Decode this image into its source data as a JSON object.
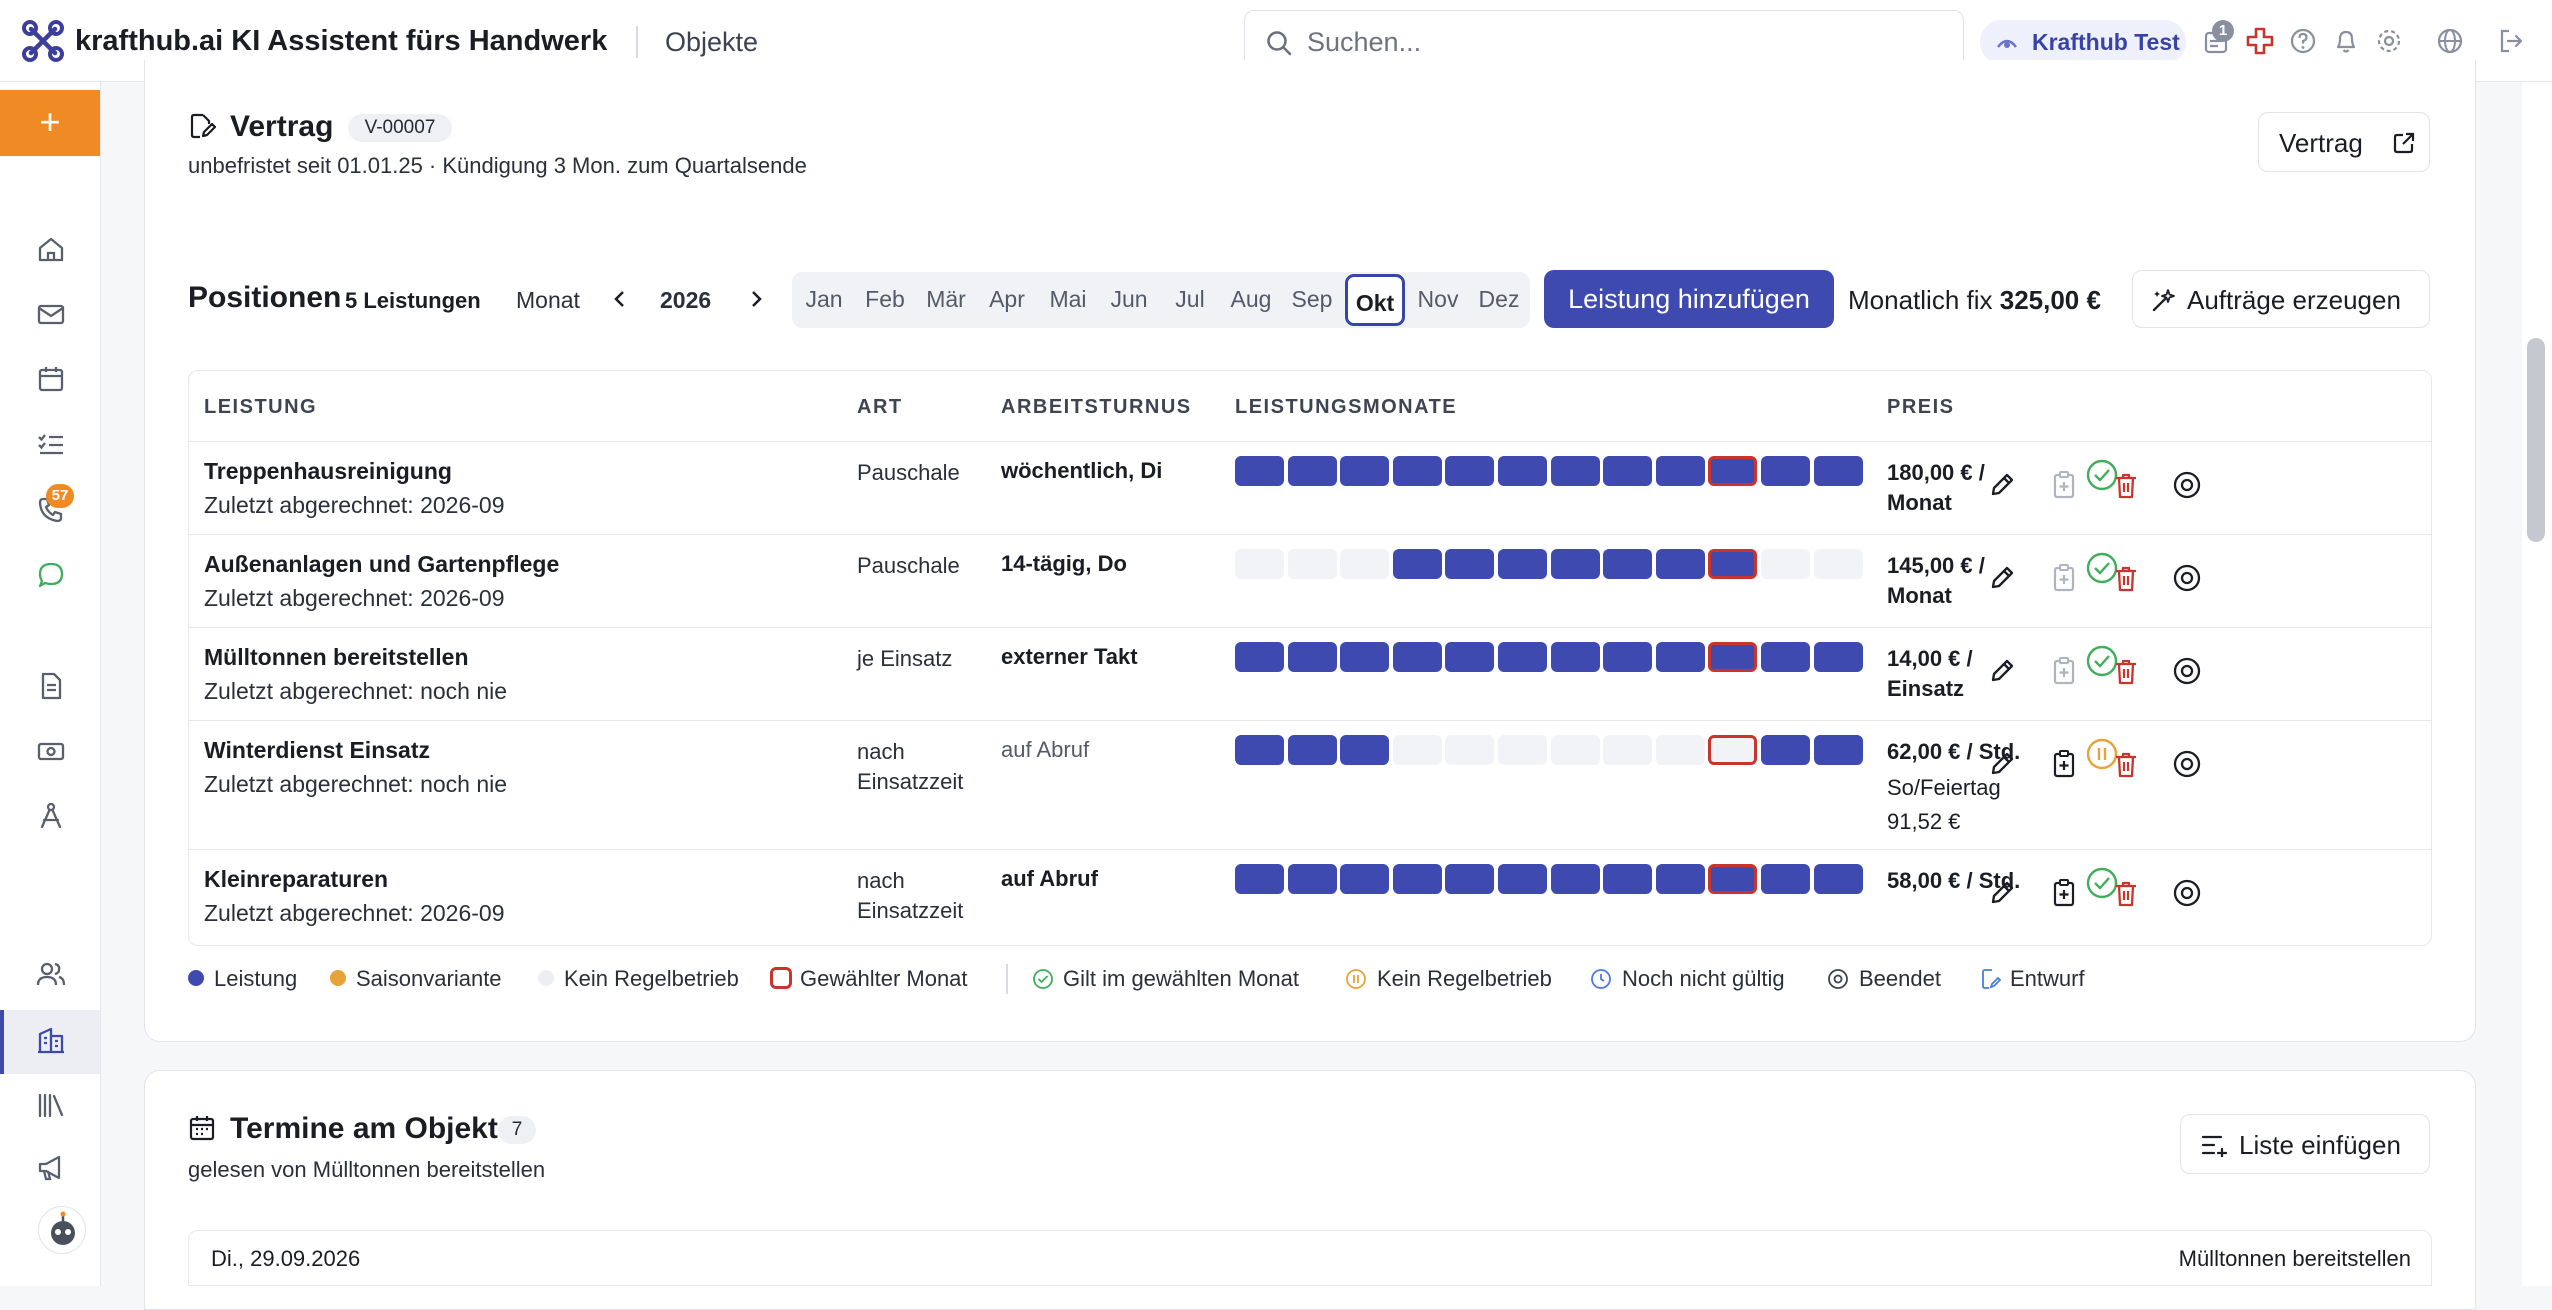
{
  "header": {
    "brand": "krafthub.ai KI Assistent fürs Handwerk",
    "breadcrumb": "Objekte",
    "search_placeholder": "Suchen...",
    "tenant": "Krafthub Test",
    "inbox_count": "1"
  },
  "sidebar": {
    "add_label": "+",
    "calls_badge": "57",
    "items": [
      "home-icon",
      "mail-icon",
      "calendar-icon",
      "tasks-icon",
      "phone-icon",
      "chat-icon",
      "document-icon",
      "money-icon",
      "compass-icon",
      "users-icon",
      "building-icon",
      "library-icon",
      "megaphone-icon"
    ],
    "active": "building-icon"
  },
  "contract": {
    "title": "Vertrag",
    "id": "V-00007",
    "subtitle": "unbefristet seit 01.01.25 · Kündigung 3 Mon. zum Quartalsende",
    "button": "Vertrag"
  },
  "positions": {
    "title": "Positionen",
    "count": "5 Leistungen",
    "period_label": "Monat",
    "year": "2026",
    "months": [
      "Jan",
      "Feb",
      "Mär",
      "Apr",
      "Mai",
      "Jun",
      "Jul",
      "Aug",
      "Sep",
      "Okt",
      "Nov",
      "Dez"
    ],
    "selected_month": "Okt",
    "add_button": "Leistung hinzufügen",
    "monthly_fixed_label": "Monatlich fix",
    "monthly_fixed_value": "325,00 €",
    "generate_button": "Aufträge erzeugen",
    "columns": [
      "LEISTUNG",
      "ART",
      "ARBEITSTURNUS",
      "LEISTUNGSMONATE",
      "PREIS"
    ],
    "rows": [
      {
        "name": "Treppenhausreinigung",
        "last": "Zuletzt abgerechnet: 2026-09",
        "art": "Pauschale",
        "turnus": "wöchentlich, Di",
        "price": "180,00 € / Monat",
        "extra": "",
        "status": "check",
        "active": [
          1,
          1,
          1,
          1,
          1,
          1,
          1,
          1,
          1,
          1,
          1,
          1
        ]
      },
      {
        "name": "Außenanlagen und Gartenpflege",
        "last": "Zuletzt abgerechnet: 2026-09",
        "art": "Pauschale",
        "turnus": "14-tägig, Do",
        "price": "145,00 € / Monat",
        "extra": "",
        "status": "check",
        "active": [
          0,
          0,
          0,
          1,
          1,
          1,
          1,
          1,
          1,
          1,
          0,
          0
        ]
      },
      {
        "name": "Mülltonnen bereitstellen",
        "last": "Zuletzt abgerechnet: noch nie",
        "art": "je Einsatz",
        "turnus": "externer Takt",
        "price": "14,00 € / Einsatz",
        "extra": "",
        "status": "check",
        "active": [
          1,
          1,
          1,
          1,
          1,
          1,
          1,
          1,
          1,
          1,
          1,
          1
        ]
      },
      {
        "name": "Winterdienst Einsatz",
        "last": "Zuletzt abgerechnet: noch nie",
        "art": "nach Einsatzzeit",
        "turnus": "auf Abruf",
        "price": "62,00 € / Std.",
        "extra": "So/Feiertag 91,52 €",
        "status": "pause",
        "active": [
          1,
          1,
          1,
          0,
          0,
          0,
          0,
          0,
          0,
          0,
          1,
          1
        ]
      },
      {
        "name": "Kleinreparaturen",
        "last": "Zuletzt abgerechnet: 2026-09",
        "art": "nach Einsatzzeit",
        "turnus": "auf Abruf",
        "price": "58,00 € / Std.",
        "extra": "",
        "status": "check",
        "active": [
          1,
          1,
          1,
          1,
          1,
          1,
          1,
          1,
          1,
          1,
          1,
          1
        ]
      }
    ],
    "legend": {
      "leistung": "Leistung",
      "saison": "Saisonvariante",
      "kein": "Kein Regelbetrieb",
      "gewaehlt": "Gewählter Monat",
      "gilt": "Gilt im gewählten Monat",
      "kein2": "Kein Regelbetrieb",
      "nochnicht": "Noch nicht gültig",
      "beendet": "Beendet",
      "entwurf": "Entwurf"
    },
    "colors": {
      "primary": "#3f4ab0",
      "selected": "#c8342e",
      "season": "#e8a23a",
      "check": "#3fae5c",
      "pause": "#e8a23a",
      "delete": "#c8342e"
    }
  },
  "appointments": {
    "title": "Termine am Objekt",
    "count": "7",
    "subtitle": "gelesen von Mülltonnen bereitstellen",
    "button": "Liste einfügen",
    "first_date": "Di., 29.09.2026",
    "first_service": "Mülltonnen bereitstellen"
  }
}
